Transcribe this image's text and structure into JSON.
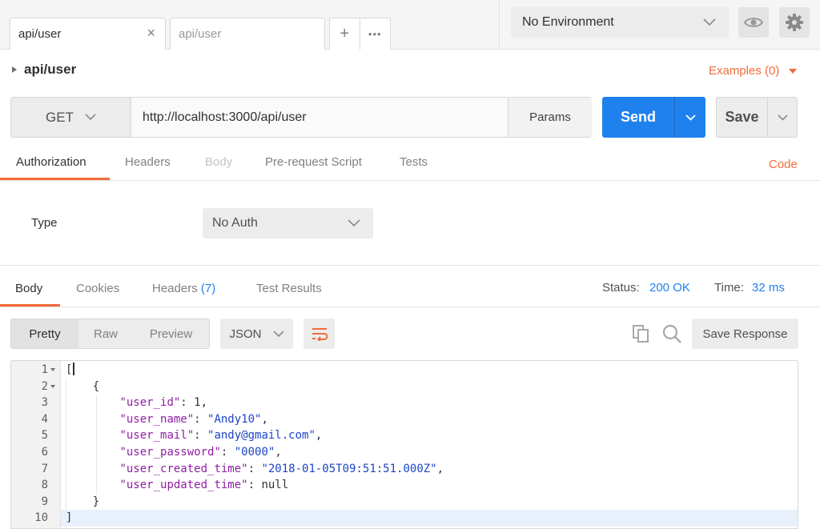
{
  "tabs": [
    {
      "label": "api/user"
    },
    {
      "label": "api/user"
    }
  ],
  "tab_controls": {
    "add": "+",
    "more": "•••",
    "close": "×"
  },
  "environment": {
    "selected": "No Environment"
  },
  "request": {
    "name": "api/user",
    "examples_label": "Examples (0)",
    "method": "GET",
    "url": "http://localhost:3000/api/user",
    "params_label": "Params",
    "send_label": "Send",
    "save_label": "Save",
    "code_label": "Code",
    "tabs": [
      "Authorization",
      "Headers",
      "Body",
      "Pre-request Script",
      "Tests"
    ]
  },
  "auth": {
    "type_label": "Type",
    "type_value": "No Auth"
  },
  "response": {
    "tabs": {
      "body": "Body",
      "cookies": "Cookies",
      "headers": "Headers",
      "headers_count": "(7)",
      "test_results": "Test Results"
    },
    "status_label": "Status:",
    "status_value": "200 OK",
    "time_label": "Time:",
    "time_value": "32 ms",
    "view_modes": [
      "Pretty",
      "Raw",
      "Preview"
    ],
    "format": "JSON",
    "save_response_label": "Save Response",
    "line_numbers": [
      "1",
      "2",
      "3",
      "4",
      "5",
      "6",
      "7",
      "8",
      "9",
      "10"
    ],
    "json": {
      "open_bracket": "[",
      "open_brace": "{",
      "fields": [
        {
          "key": "\"user_id\"",
          "value": "1",
          "comma": ","
        },
        {
          "key": "\"user_name\"",
          "value": "\"Andy10\"",
          "comma": ","
        },
        {
          "key": "\"user_mail\"",
          "value": "\"andy@gmail.com\"",
          "comma": ","
        },
        {
          "key": "\"user_password\"",
          "value": "\"0000\"",
          "comma": ","
        },
        {
          "key": "\"user_created_time\"",
          "value": "\"2018-01-05T09:51:51.000Z\"",
          "comma": ","
        },
        {
          "key": "\"user_updated_time\"",
          "value": "null",
          "comma": ""
        }
      ],
      "close_brace": "}",
      "close_bracket": "]"
    }
  },
  "colors": {
    "accent": "#f26b3a",
    "primary": "#1f81ee",
    "json_key": "#8f1fa3",
    "json_string": "#1c45c8"
  },
  "icons": [
    "close-icon",
    "plus-icon",
    "more-icon",
    "chevron-down-icon",
    "eye-icon",
    "gear-icon",
    "caret-right-icon",
    "wrap-icon",
    "copy-icon",
    "search-icon"
  ]
}
